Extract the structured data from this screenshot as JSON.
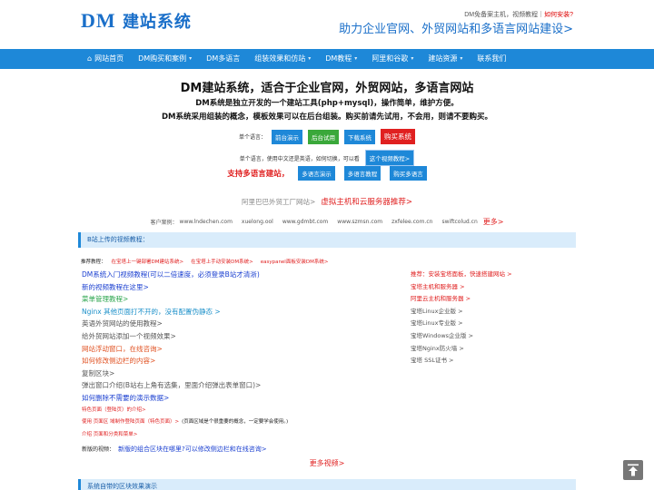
{
  "header": {
    "logo_dm": "DM",
    "logo_text": "建站系统",
    "top_note": "DM免备案主机，视频教程｜",
    "top_how": "如何安装?",
    "slogan": "助力企业官网、外贸网站和多语言网站建设>"
  },
  "nav": {
    "items": [
      {
        "label": "网站首页",
        "caret": false
      },
      {
        "label": "DM购买和案例",
        "caret": true
      },
      {
        "label": "DM多语言",
        "caret": false
      },
      {
        "label": "组装效果和仿站",
        "caret": true
      },
      {
        "label": "DM教程",
        "caret": true
      },
      {
        "label": "阿里和谷歌",
        "caret": true
      },
      {
        "label": "建站资源",
        "caret": true
      },
      {
        "label": "联系我们",
        "caret": false
      }
    ]
  },
  "hero": {
    "title": "DM建站系统，适合于企业官网，外贸网站，多语言网站",
    "line1": "DM系统是独立开发的一个建站工具(php+mysql)，操作简单，维护方便。",
    "line2": "DM系统采用组装的概念，模板效果可以在后台组装。购买前请先试用，不会用，则请不要购买。"
  },
  "lang_row": {
    "label": "单个语言：",
    "buttons": [
      "前台演示",
      "后台试用",
      "下载系统",
      "购买系统"
    ]
  },
  "lang_note": {
    "text": "单个语言，使用中文还是英语，如何切换，可以看",
    "button": "这个视频教程>"
  },
  "multi_row": {
    "label": "支持多语言建站，",
    "buttons": [
      "多语言演示",
      "多语言教程",
      "购买多语言"
    ]
  },
  "server_row": {
    "gray": "阿里巴巴外贸工厂网站>",
    "red": "虚拟主机和云服务器推荐>"
  },
  "cases": {
    "label": "客户案例：",
    "sites": [
      "www.lndechen.com",
      "xuelong.ool",
      "www.gdmbt.com",
      "www.szmsn.com",
      "zxfelee.com.cn",
      "swiftcolud.cn"
    ],
    "more": "更多>"
  },
  "section1": {
    "title": "B站上传的视频教程："
  },
  "tutorial_row": {
    "label": "推荐教程：",
    "links": [
      "在宝塔上一键部署DM建站系统>",
      "在宝塔上手动安装DM系统>",
      "easypanel面板安装DM系统>"
    ]
  },
  "left_list": [
    {
      "text": "DM系统入门视频教程(可以二倍速度，必须登录B站才清淅)",
      "color": "#1a3fd0",
      "small": false
    },
    {
      "text": "新的视频教程在这里>",
      "color": "#1a3fd0",
      "small": false
    },
    {
      "text": "菜单管理教程>",
      "color": "#2ba54d",
      "small": false
    },
    {
      "text": "Nginx 其他页面打不开的，没有配置伪静态 >",
      "color": "#1a8fc9",
      "small": false
    },
    {
      "text": "英语外贸网站的使用教程>",
      "color": "#555555",
      "small": false
    },
    {
      "text": "给外贸网站添加一个视频效果>",
      "color": "#555555",
      "small": false
    },
    {
      "text": "网站浮动窗口，在线咨询>",
      "color": "#e05020",
      "small": false
    },
    {
      "text": "如何修改侧边栏的内容>",
      "color": "#e05020",
      "small": false
    },
    {
      "text": "复制区块>",
      "color": "#555555",
      "small": false
    },
    {
      "text": "弹出窗口介绍(B站右上角有选集，里面介绍弹出表单窗口)>",
      "color": "#555555",
      "small": false
    },
    {
      "text": "如何删除不需要的演示数据>",
      "color": "#1a3fd0",
      "small": false
    },
    {
      "text": "特色页面（登陆页）的介绍>",
      "color": "#e02020",
      "small": true
    },
    {
      "text": "使用 页面区 域制作登陆页面（特色页面）>",
      "color": "#e02020",
      "small": true,
      "suffix": "(页面区域是个很重要的概念，一定要学会使用。)"
    },
    {
      "text": "介绍 页面和分类和菜单>",
      "color": "#e02020",
      "small": true
    }
  ],
  "right_list": [
    {
      "text": "推荐：安装宝塔面板，快速搭建网站 >",
      "color": "#e02020"
    },
    {
      "text": "宝塔主机和服务器 >",
      "color": "#e02020"
    },
    {
      "text": "阿里云主机和服务器 >",
      "color": "#e02020"
    },
    {
      "text": "宝塔Linux企业版 >",
      "color": "#555555"
    },
    {
      "text": "宝塔Linux专业版 >",
      "color": "#555555"
    },
    {
      "text": "宝塔Windows企业版 >",
      "color": "#555555"
    },
    {
      "text": "宝塔Nginx防火墙 >",
      "color": "#555555"
    },
    {
      "text": "宝塔 SSL证书 >",
      "color": "#555555"
    }
  ],
  "new_video": {
    "label": "新版的视频：",
    "link": "新版的组合区块在哪里?可以修改侧边栏和在线咨询>"
  },
  "more_video": "更多视频>",
  "section2": {
    "title": "系统自带的区块效果演示"
  },
  "icons": {
    "home": "home-icon",
    "back_top": "arrow-up-icon"
  },
  "colors": {
    "accent": "#1e88d8",
    "red": "#e02020",
    "green": "#3aa83a",
    "section_bg": "#d9ecfb"
  }
}
